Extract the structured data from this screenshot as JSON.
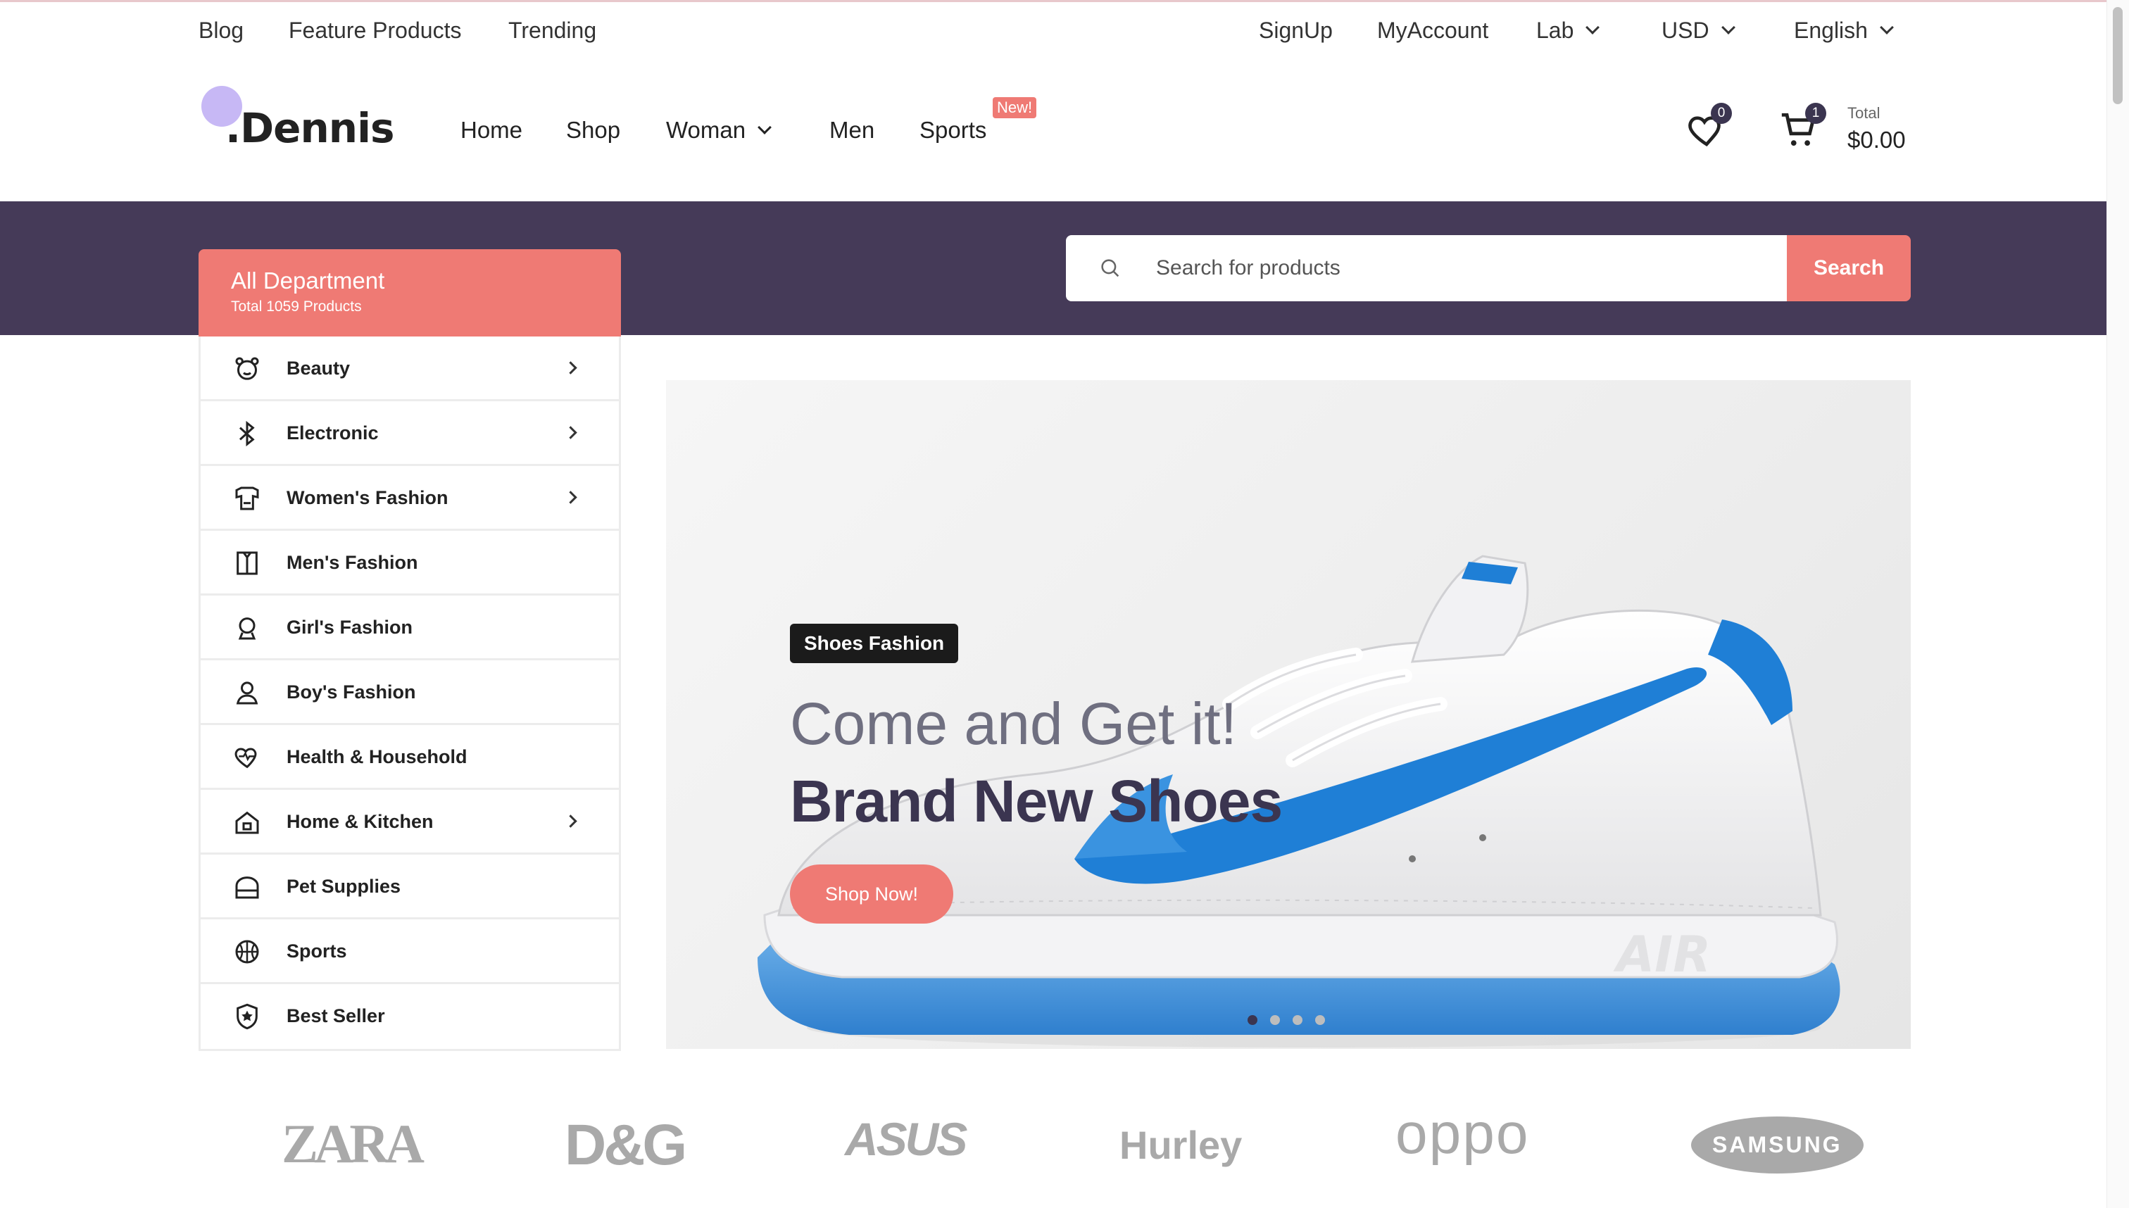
{
  "topbar": {
    "left_links": [
      "Blog",
      "Feature Products",
      "Trending"
    ],
    "signup": "SignUp",
    "account": "MyAccount",
    "lab": "Lab",
    "currency": "USD",
    "language": "English"
  },
  "header": {
    "logo": ".Dennis",
    "nav": [
      "Home",
      "Shop",
      "Woman",
      "Men",
      "Sports"
    ],
    "sports_badge": "New!",
    "wishlist_count": "0",
    "cart_count": "1",
    "total_label": "Total",
    "total_value": "$0.00"
  },
  "department": {
    "title": "All Department",
    "subtitle": "Total 1059 Products",
    "categories": [
      {
        "label": "Beauty",
        "icon": "bear-face-icon",
        "has_sub": true
      },
      {
        "label": "Electronic",
        "icon": "bluetooth-icon",
        "has_sub": true
      },
      {
        "label": "Women's Fashion",
        "icon": "dress-icon",
        "has_sub": true
      },
      {
        "label": "Men's Fashion",
        "icon": "shirt-icon",
        "has_sub": false
      },
      {
        "label": "Girl's Fashion",
        "icon": "girl-icon",
        "has_sub": false
      },
      {
        "label": "Boy's Fashion",
        "icon": "person-icon",
        "has_sub": false
      },
      {
        "label": "Health & Household",
        "icon": "heartbeat-icon",
        "has_sub": false
      },
      {
        "label": "Home & Kitchen",
        "icon": "house-icon",
        "has_sub": true
      },
      {
        "label": "Pet Supplies",
        "icon": "pet-carrier-icon",
        "has_sub": false
      },
      {
        "label": "Sports",
        "icon": "basketball-icon",
        "has_sub": false
      },
      {
        "label": "Best Seller",
        "icon": "star-shield-icon",
        "has_sub": false
      }
    ]
  },
  "search": {
    "placeholder": "Search for products",
    "button": "Search"
  },
  "hero": {
    "tag": "Shoes Fashion",
    "line1": "Come and Get it!",
    "line2": "Brand New Shoes",
    "cta": "Shop Now!",
    "slides": 4,
    "active_slide": 1
  },
  "brands": [
    "ZARA",
    "D&G",
    "ASUS",
    "Hurley",
    "oppo",
    "SAMSUNG"
  ],
  "colors": {
    "accent": "#ef7a74",
    "band": "#453a58",
    "dark": "#3b3550",
    "swoosh": "#1f7fd6"
  }
}
